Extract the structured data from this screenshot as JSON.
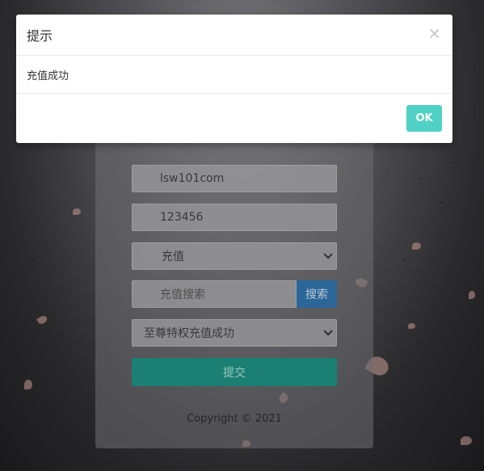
{
  "form": {
    "username_value": "lsw101com",
    "password_value": "123456",
    "type_select": "充值",
    "search_placeholder": "充值搜索",
    "search_button": "搜索",
    "package_select": "至尊特权充值成功",
    "submit_label": "提交",
    "copyright": "Copyright © 2021"
  },
  "modal": {
    "title": "提示",
    "close_glyph": "×",
    "message": "充值成功",
    "ok_label": "OK"
  },
  "colors": {
    "accent": "#4fd1c5",
    "submit": "#1f8a7d",
    "search_button": "#2f6fa6"
  },
  "icons": [
    "close-icon",
    "chevron-down-icon"
  ]
}
